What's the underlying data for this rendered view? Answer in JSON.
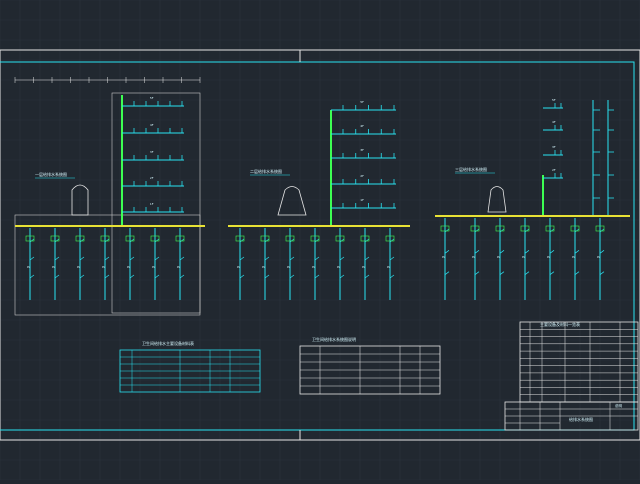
{
  "colors": {
    "background": "#212830",
    "grid": "#2b333c",
    "frame": "#e6e6e6",
    "pipe": "#29e3f2",
    "main_pipe": "#e8e235",
    "riser": "#3dff52",
    "text": "#d8f8ff"
  },
  "drawing": {
    "section_labels": [
      "一层给排水系统图",
      "二层给排水系统图",
      "三层给排水系统图"
    ],
    "floor_tags": [
      "5F",
      "4F",
      "3F",
      "2F",
      "1F"
    ],
    "branch_tag": "JL",
    "drain_tag": "PL"
  },
  "tables": {
    "left_title": "卫生间给排水主要设备材料表",
    "mid_title": "卫生间给排水系统图说明",
    "right_title": "主要设备及材料一览表"
  },
  "title_block": {
    "drawing_name": "给排水系统图",
    "note": "说明"
  }
}
